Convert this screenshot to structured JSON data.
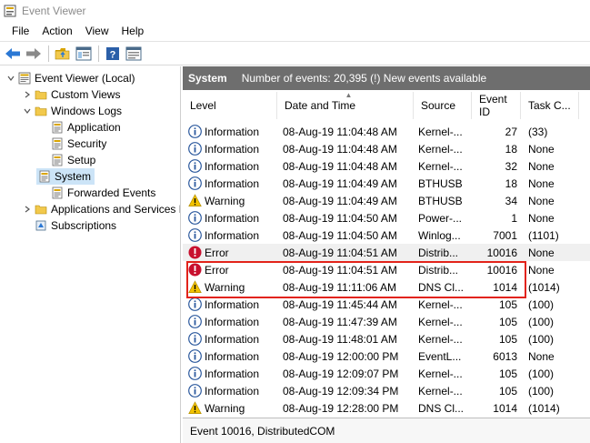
{
  "window": {
    "title": "Event Viewer"
  },
  "menu": [
    "File",
    "Action",
    "View",
    "Help"
  ],
  "toolbar": {
    "buttons": [
      "back-arrow-icon",
      "forward-arrow-icon",
      "open-folder-icon",
      "panel-icon",
      "help-icon",
      "properties-icon"
    ]
  },
  "tree": [
    {
      "label": "Event Viewer (Local)",
      "icon": "event-viewer-icon",
      "depth": 0,
      "chevron": "open"
    },
    {
      "label": "Custom Views",
      "icon": "folder-icon",
      "depth": 1,
      "chevron": "closed"
    },
    {
      "label": "Windows Logs",
      "icon": "folder-icon",
      "depth": 1,
      "chevron": "open"
    },
    {
      "label": "Application",
      "icon": "log-icon",
      "depth": 2,
      "chevron": ""
    },
    {
      "label": "Security",
      "icon": "log-icon",
      "depth": 2,
      "chevron": ""
    },
    {
      "label": "Setup",
      "icon": "log-icon",
      "depth": 2,
      "chevron": ""
    },
    {
      "label": "System",
      "icon": "log-icon",
      "depth": 2,
      "chevron": "",
      "selected": true
    },
    {
      "label": "Forwarded Events",
      "icon": "log-icon",
      "depth": 2,
      "chevron": ""
    },
    {
      "label": "Applications and Services Lo",
      "icon": "folder-icon",
      "depth": 1,
      "chevron": "closed"
    },
    {
      "label": "Subscriptions",
      "icon": "subscriptions-icon",
      "depth": 1,
      "chevron": ""
    }
  ],
  "header": {
    "log_name": "System",
    "summary": "Number of events: 20,395 (!) New events available"
  },
  "columns": [
    "Level",
    "Date and Time",
    "Source",
    "Event ID",
    "Task C..."
  ],
  "events": [
    {
      "level": "Information",
      "date": "08-Aug-19 11:04:48 AM",
      "source": "Kernel-...",
      "id": "27",
      "task": "(33)"
    },
    {
      "level": "Information",
      "date": "08-Aug-19 11:04:48 AM",
      "source": "Kernel-...",
      "id": "18",
      "task": "None"
    },
    {
      "level": "Information",
      "date": "08-Aug-19 11:04:48 AM",
      "source": "Kernel-...",
      "id": "32",
      "task": "None"
    },
    {
      "level": "Information",
      "date": "08-Aug-19 11:04:49 AM",
      "source": "BTHUSB",
      "id": "18",
      "task": "None"
    },
    {
      "level": "Warning",
      "date": "08-Aug-19 11:04:49 AM",
      "source": "BTHUSB",
      "id": "34",
      "task": "None"
    },
    {
      "level": "Information",
      "date": "08-Aug-19 11:04:50 AM",
      "source": "Power-...",
      "id": "1",
      "task": "None"
    },
    {
      "level": "Information",
      "date": "08-Aug-19 11:04:50 AM",
      "source": "Winlog...",
      "id": "7001",
      "task": "(1101)"
    },
    {
      "level": "Error",
      "date": "08-Aug-19 11:04:51 AM",
      "source": "Distrib...",
      "id": "10016",
      "task": "None",
      "selected": true
    },
    {
      "level": "Error",
      "date": "08-Aug-19 11:04:51 AM",
      "source": "Distrib...",
      "id": "10016",
      "task": "None"
    },
    {
      "level": "Warning",
      "date": "08-Aug-19 11:11:06 AM",
      "source": "DNS Cl...",
      "id": "1014",
      "task": "(1014)"
    },
    {
      "level": "Information",
      "date": "08-Aug-19 11:45:44 AM",
      "source": "Kernel-...",
      "id": "105",
      "task": "(100)"
    },
    {
      "level": "Information",
      "date": "08-Aug-19 11:47:39 AM",
      "source": "Kernel-...",
      "id": "105",
      "task": "(100)"
    },
    {
      "level": "Information",
      "date": "08-Aug-19 11:48:01 AM",
      "source": "Kernel-...",
      "id": "105",
      "task": "(100)"
    },
    {
      "level": "Information",
      "date": "08-Aug-19 12:00:00 PM",
      "source": "EventL...",
      "id": "6013",
      "task": "None"
    },
    {
      "level": "Information",
      "date": "08-Aug-19 12:09:07 PM",
      "source": "Kernel-...",
      "id": "105",
      "task": "(100)"
    },
    {
      "level": "Information",
      "date": "08-Aug-19 12:09:34 PM",
      "source": "Kernel-...",
      "id": "105",
      "task": "(100)"
    },
    {
      "level": "Warning",
      "date": "08-Aug-19 12:28:00 PM",
      "source": "DNS Cl...",
      "id": "1014",
      "task": "(1014)"
    }
  ],
  "detail": {
    "title": "Event 10016, DistributedCOM"
  },
  "colors": {
    "header_band": "#6e6e6e",
    "highlight": "#e2231a",
    "selection": "#cce4f7",
    "info": "#2d5a9e",
    "warning": "#f2c200",
    "error": "#c8102e"
  }
}
